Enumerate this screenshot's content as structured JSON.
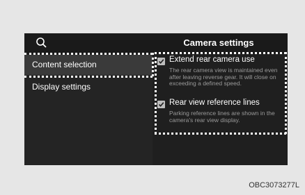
{
  "header": {
    "title": "Camera settings",
    "search_icon": "search-icon"
  },
  "sidebar": {
    "items": [
      {
        "label": "Content selection",
        "selected": true
      },
      {
        "label": "Display settings",
        "selected": false
      }
    ]
  },
  "options": [
    {
      "label": "Extend rear camera use",
      "checked": true,
      "description": "The rear camera view is maintained even after leaving reverse gear. It will close on exceeding a defined speed."
    },
    {
      "label": "Rear view reference lines",
      "checked": true,
      "description": "Parking reference lines are shown in the camera's rear view display."
    }
  ],
  "caption": "OBC3073277L",
  "colors": {
    "screen_bg": "#1f1f1f",
    "highlight": "#ffffff",
    "checkbox": "#bdbdbd"
  }
}
